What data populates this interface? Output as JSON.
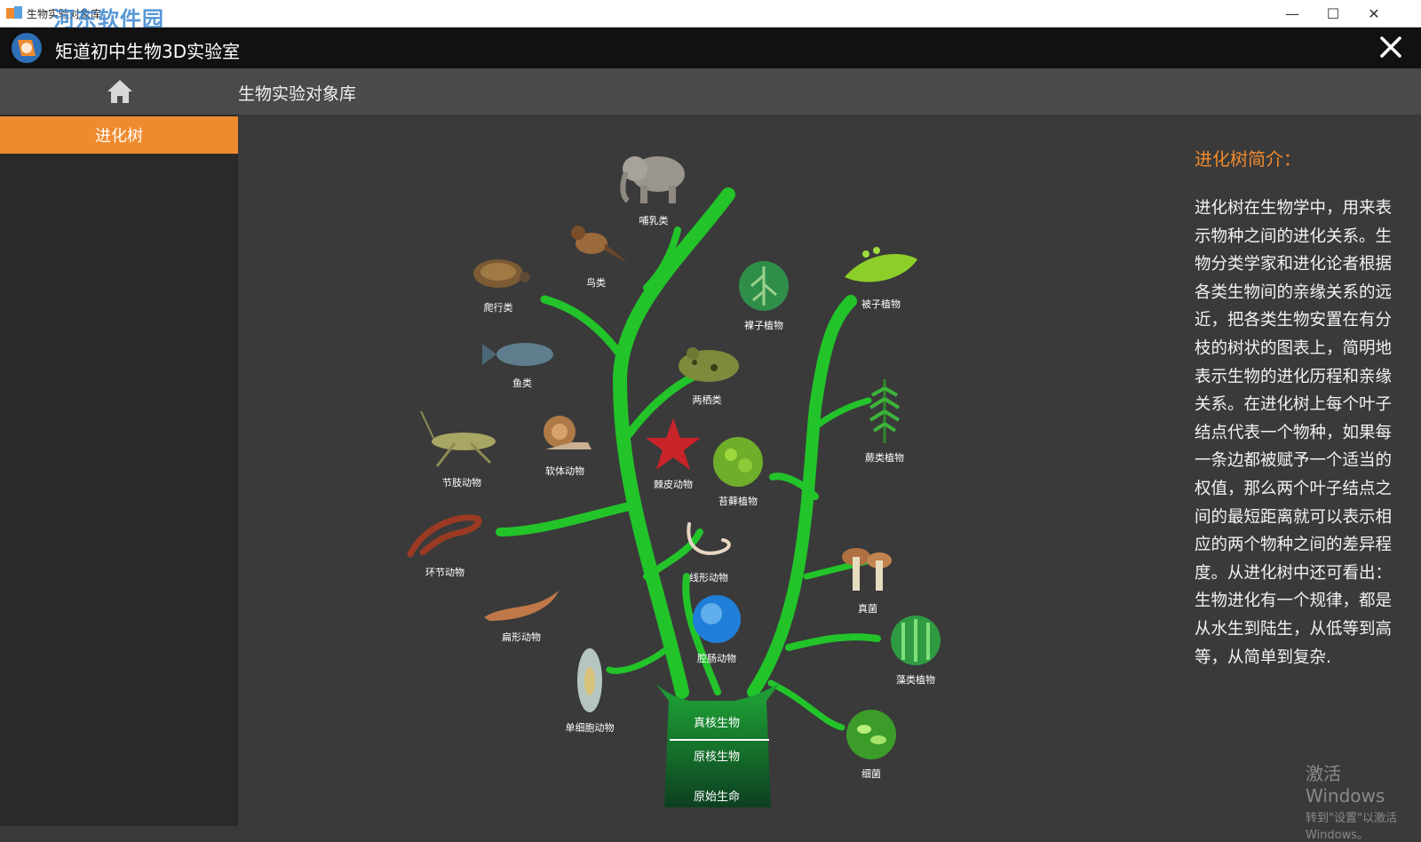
{
  "window": {
    "title": "生物实验对象库",
    "watermark": "河东软件园",
    "minimize": "—",
    "maximize": "☐",
    "close": "✕"
  },
  "app": {
    "title": "矩道初中生物3D实验室"
  },
  "nav": {
    "title": "生物实验对象库"
  },
  "sidebar": {
    "items": [
      {
        "label": "进化树"
      }
    ]
  },
  "tree": {
    "trunk": [
      "真核生物",
      "原核生物",
      "原始生命"
    ],
    "nodes": {
      "mammal": "哺乳类",
      "bird": "鸟类",
      "reptile": "爬行类",
      "fish": "鱼类",
      "amphibian": "两栖类",
      "arthropod": "节肢动物",
      "mollusk": "软体动物",
      "echinoderm": "棘皮动物",
      "annelid": "环节动物",
      "nematode": "线形动物",
      "flatworm": "扁形动物",
      "cnidarian": "腔肠动物",
      "protozoa": "单细胞动物",
      "gymnosperm": "裸子植物",
      "angiosperm": "被子植物",
      "fern": "蕨类植物",
      "moss": "苔藓植物",
      "fungi": "真菌",
      "algae": "藻类植物",
      "bacteria": "细菌"
    }
  },
  "intro": {
    "title": "进化树简介：",
    "text": "进化树在生物学中，用来表示物种之间的进化关系。生物分类学家和进化论者根据各类生物间的亲缘关系的远近，把各类生物安置在有分枝的树状的图表上，简明地表示生物的进化历程和亲缘关系。在进化树上每个叶子结点代表一个物种，如果每一条边都被赋予一个适当的权值，那么两个叶子结点之间的最短距离就可以表示相应的两个物种之间的差异程度。从进化树中还可看出：生物进化有一个规律，都是从水生到陆生，从低等到高等，从简单到复杂."
  },
  "activation": {
    "line1": "激活 Windows",
    "line2": "转到\"设置\"以激活 Windows。"
  },
  "colors": {
    "accent": "#f08a2e",
    "tree_green": "#22c42a",
    "trunk_dark": "#0f4a24"
  }
}
